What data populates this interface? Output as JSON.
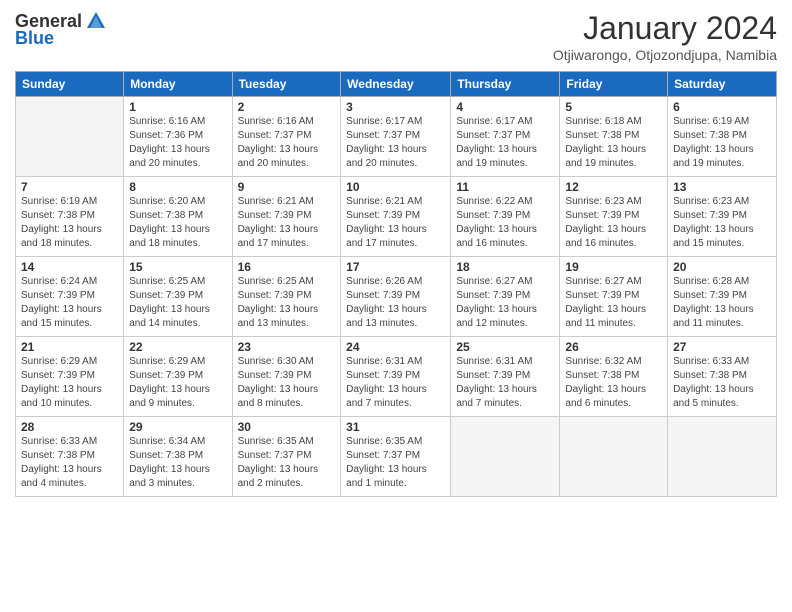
{
  "logo": {
    "general": "General",
    "blue": "Blue"
  },
  "title": "January 2024",
  "location": "Otjiwarongo, Otjozondjupa, Namibia",
  "days_of_week": [
    "Sunday",
    "Monday",
    "Tuesday",
    "Wednesday",
    "Thursday",
    "Friday",
    "Saturday"
  ],
  "weeks": [
    [
      {
        "day": "",
        "sunrise": "",
        "sunset": "",
        "daylight": "",
        "empty": true
      },
      {
        "day": "1",
        "sunrise": "Sunrise: 6:16 AM",
        "sunset": "Sunset: 7:36 PM",
        "daylight": "Daylight: 13 hours and 20 minutes."
      },
      {
        "day": "2",
        "sunrise": "Sunrise: 6:16 AM",
        "sunset": "Sunset: 7:37 PM",
        "daylight": "Daylight: 13 hours and 20 minutes."
      },
      {
        "day": "3",
        "sunrise": "Sunrise: 6:17 AM",
        "sunset": "Sunset: 7:37 PM",
        "daylight": "Daylight: 13 hours and 20 minutes."
      },
      {
        "day": "4",
        "sunrise": "Sunrise: 6:17 AM",
        "sunset": "Sunset: 7:37 PM",
        "daylight": "Daylight: 13 hours and 19 minutes."
      },
      {
        "day": "5",
        "sunrise": "Sunrise: 6:18 AM",
        "sunset": "Sunset: 7:38 PM",
        "daylight": "Daylight: 13 hours and 19 minutes."
      },
      {
        "day": "6",
        "sunrise": "Sunrise: 6:19 AM",
        "sunset": "Sunset: 7:38 PM",
        "daylight": "Daylight: 13 hours and 19 minutes."
      }
    ],
    [
      {
        "day": "7",
        "sunrise": "Sunrise: 6:19 AM",
        "sunset": "Sunset: 7:38 PM",
        "daylight": "Daylight: 13 hours and 18 minutes."
      },
      {
        "day": "8",
        "sunrise": "Sunrise: 6:20 AM",
        "sunset": "Sunset: 7:38 PM",
        "daylight": "Daylight: 13 hours and 18 minutes."
      },
      {
        "day": "9",
        "sunrise": "Sunrise: 6:21 AM",
        "sunset": "Sunset: 7:39 PM",
        "daylight": "Daylight: 13 hours and 17 minutes."
      },
      {
        "day": "10",
        "sunrise": "Sunrise: 6:21 AM",
        "sunset": "Sunset: 7:39 PM",
        "daylight": "Daylight: 13 hours and 17 minutes."
      },
      {
        "day": "11",
        "sunrise": "Sunrise: 6:22 AM",
        "sunset": "Sunset: 7:39 PM",
        "daylight": "Daylight: 13 hours and 16 minutes."
      },
      {
        "day": "12",
        "sunrise": "Sunrise: 6:23 AM",
        "sunset": "Sunset: 7:39 PM",
        "daylight": "Daylight: 13 hours and 16 minutes."
      },
      {
        "day": "13",
        "sunrise": "Sunrise: 6:23 AM",
        "sunset": "Sunset: 7:39 PM",
        "daylight": "Daylight: 13 hours and 15 minutes."
      }
    ],
    [
      {
        "day": "14",
        "sunrise": "Sunrise: 6:24 AM",
        "sunset": "Sunset: 7:39 PM",
        "daylight": "Daylight: 13 hours and 15 minutes."
      },
      {
        "day": "15",
        "sunrise": "Sunrise: 6:25 AM",
        "sunset": "Sunset: 7:39 PM",
        "daylight": "Daylight: 13 hours and 14 minutes."
      },
      {
        "day": "16",
        "sunrise": "Sunrise: 6:25 AM",
        "sunset": "Sunset: 7:39 PM",
        "daylight": "Daylight: 13 hours and 13 minutes."
      },
      {
        "day": "17",
        "sunrise": "Sunrise: 6:26 AM",
        "sunset": "Sunset: 7:39 PM",
        "daylight": "Daylight: 13 hours and 13 minutes."
      },
      {
        "day": "18",
        "sunrise": "Sunrise: 6:27 AM",
        "sunset": "Sunset: 7:39 PM",
        "daylight": "Daylight: 13 hours and 12 minutes."
      },
      {
        "day": "19",
        "sunrise": "Sunrise: 6:27 AM",
        "sunset": "Sunset: 7:39 PM",
        "daylight": "Daylight: 13 hours and 11 minutes."
      },
      {
        "day": "20",
        "sunrise": "Sunrise: 6:28 AM",
        "sunset": "Sunset: 7:39 PM",
        "daylight": "Daylight: 13 hours and 11 minutes."
      }
    ],
    [
      {
        "day": "21",
        "sunrise": "Sunrise: 6:29 AM",
        "sunset": "Sunset: 7:39 PM",
        "daylight": "Daylight: 13 hours and 10 minutes."
      },
      {
        "day": "22",
        "sunrise": "Sunrise: 6:29 AM",
        "sunset": "Sunset: 7:39 PM",
        "daylight": "Daylight: 13 hours and 9 minutes."
      },
      {
        "day": "23",
        "sunrise": "Sunrise: 6:30 AM",
        "sunset": "Sunset: 7:39 PM",
        "daylight": "Daylight: 13 hours and 8 minutes."
      },
      {
        "day": "24",
        "sunrise": "Sunrise: 6:31 AM",
        "sunset": "Sunset: 7:39 PM",
        "daylight": "Daylight: 13 hours and 7 minutes."
      },
      {
        "day": "25",
        "sunrise": "Sunrise: 6:31 AM",
        "sunset": "Sunset: 7:39 PM",
        "daylight": "Daylight: 13 hours and 7 minutes."
      },
      {
        "day": "26",
        "sunrise": "Sunrise: 6:32 AM",
        "sunset": "Sunset: 7:38 PM",
        "daylight": "Daylight: 13 hours and 6 minutes."
      },
      {
        "day": "27",
        "sunrise": "Sunrise: 6:33 AM",
        "sunset": "Sunset: 7:38 PM",
        "daylight": "Daylight: 13 hours and 5 minutes."
      }
    ],
    [
      {
        "day": "28",
        "sunrise": "Sunrise: 6:33 AM",
        "sunset": "Sunset: 7:38 PM",
        "daylight": "Daylight: 13 hours and 4 minutes."
      },
      {
        "day": "29",
        "sunrise": "Sunrise: 6:34 AM",
        "sunset": "Sunset: 7:38 PM",
        "daylight": "Daylight: 13 hours and 3 minutes."
      },
      {
        "day": "30",
        "sunrise": "Sunrise: 6:35 AM",
        "sunset": "Sunset: 7:37 PM",
        "daylight": "Daylight: 13 hours and 2 minutes."
      },
      {
        "day": "31",
        "sunrise": "Sunrise: 6:35 AM",
        "sunset": "Sunset: 7:37 PM",
        "daylight": "Daylight: 13 hours and 1 minute."
      },
      {
        "day": "",
        "sunrise": "",
        "sunset": "",
        "daylight": "",
        "empty": true
      },
      {
        "day": "",
        "sunrise": "",
        "sunset": "",
        "daylight": "",
        "empty": true
      },
      {
        "day": "",
        "sunrise": "",
        "sunset": "",
        "daylight": "",
        "empty": true
      }
    ]
  ]
}
